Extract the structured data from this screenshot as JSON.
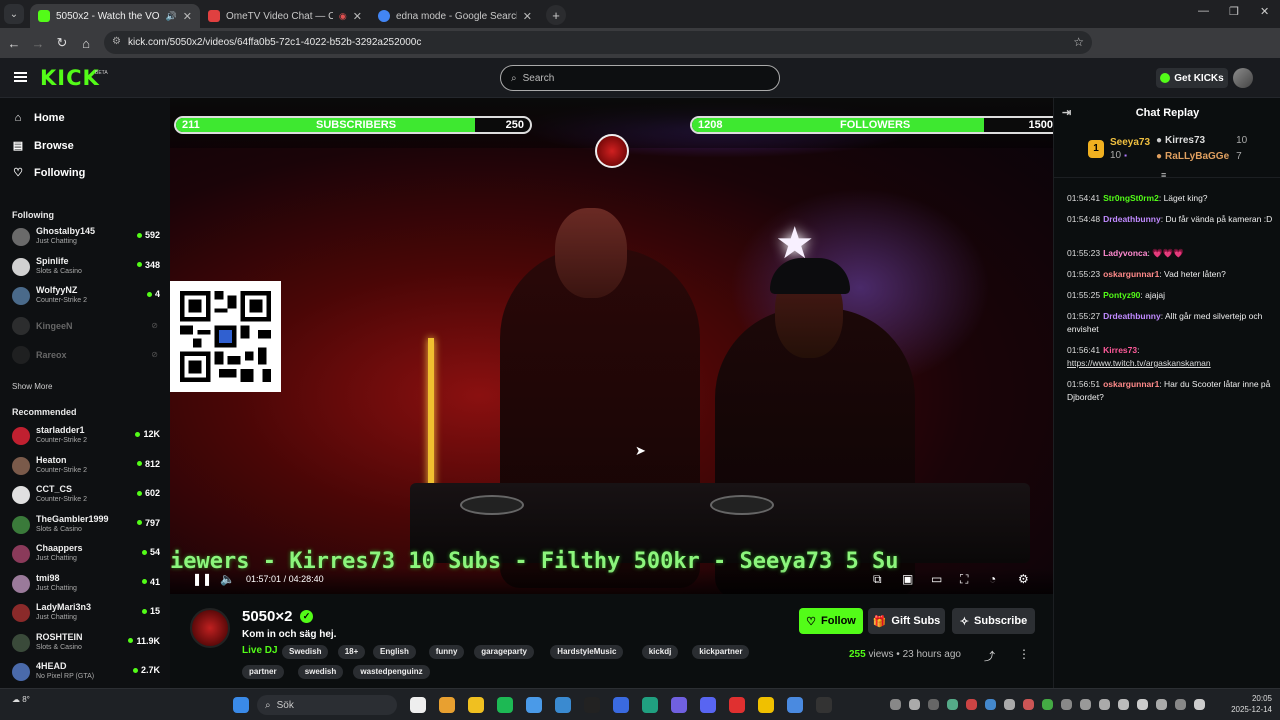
{
  "browser": {
    "tabs": [
      {
        "title": "5050x2 - Watch the VOD o",
        "active": true,
        "color": "#53fc18"
      },
      {
        "title": "OmeTV Video Chat — Ome",
        "active": false,
        "color": "#e04040"
      },
      {
        "title": "edna mode - Google Search",
        "active": false,
        "color": "#4285f4"
      }
    ],
    "url": "kick.com/5050x2/videos/64ffa0b5-72c1-4022-b52b-3292a252000c",
    "new_tab": "+",
    "close_glyph": "✕",
    "min_glyph": "—",
    "max_glyph": "❐"
  },
  "header": {
    "logo": "KICK",
    "beta": "BETA",
    "search_placeholder": "Search",
    "get_kicks": "Get KICKs"
  },
  "sidebar": {
    "nav": [
      {
        "label": "Home",
        "icon": "⌂"
      },
      {
        "label": "Browse",
        "icon": "▤"
      },
      {
        "label": "Following",
        "icon": "♡"
      }
    ],
    "following_title": "Following",
    "following": [
      {
        "name": "Ghostalby145",
        "category": "Just Chatting",
        "viewers": "592",
        "color": "#6a6a6a"
      },
      {
        "name": "Spinlife",
        "category": "Slots & Casino",
        "viewers": "348",
        "color": "#d0d0d0"
      },
      {
        "name": "WolfyyNZ",
        "category": "Counter-Strike 2",
        "viewers": "4",
        "color": "#4a6a8a"
      },
      {
        "name": "KingeeN",
        "category": "",
        "viewers": "",
        "color": "#5a5a5a"
      },
      {
        "name": "Rareox",
        "category": "",
        "viewers": "",
        "color": "#3a3a3a"
      }
    ],
    "show_more": "Show More",
    "recommended_title": "Recommended",
    "recommended": [
      {
        "name": "starladder1",
        "category": "Counter-Strike 2",
        "viewers": "12K",
        "color": "#c02030"
      },
      {
        "name": "Heaton",
        "category": "Counter-Strike 2",
        "viewers": "812",
        "color": "#7a5a4a"
      },
      {
        "name": "CCT_CS",
        "category": "Counter-Strike 2",
        "viewers": "602",
        "color": "#e0e0e0"
      },
      {
        "name": "TheGambler1999",
        "category": "Slots & Casino",
        "viewers": "797",
        "color": "#3a7a3a"
      },
      {
        "name": "Chaappers",
        "category": "Just Chatting",
        "viewers": "54",
        "color": "#8a3a5a"
      },
      {
        "name": "tmi98",
        "category": "Just Chatting",
        "viewers": "41",
        "color": "#9a7a9a"
      },
      {
        "name": "LadyMari3n3",
        "category": "Just Chatting",
        "viewers": "15",
        "color": "#8a2a2a"
      },
      {
        "name": "ROSHTEIN",
        "category": "Slots & Casino",
        "viewers": "11.9K",
        "color": "#3a4a3a"
      },
      {
        "name": "4HEAD",
        "category": "No Pixel RP (GTA)",
        "viewers": "2.7K",
        "color": "#4a6aaa"
      }
    ]
  },
  "video": {
    "subs": {
      "current": "211",
      "label": "SUBSCRIBERS",
      "goal": "250",
      "progress": 0.844
    },
    "followers": {
      "current": "1208",
      "label": "FOLLOWERS",
      "goal": "1500",
      "progress": 0.805
    },
    "ticker": "iewers - Kirres73 10 Subs - Filthy 500kr - Seeya73 5 Su",
    "time_current": "01:57:01",
    "time_total": "04:28:40",
    "time_sep": "/"
  },
  "stream": {
    "channel": "5050×2",
    "title": "Kom in och säg hej.",
    "category": "Live DJ",
    "tags": [
      "Swedish",
      "18+",
      "English",
      "funny",
      "garageparty",
      "HardstyleMusic",
      "kickdj",
      "kickpartner",
      "partner",
      "swedish",
      "wastedpenguinz"
    ],
    "follow": "Follow",
    "gift_subs": "Gift Subs",
    "subscribe": "Subscribe",
    "views_count": "255",
    "views_label": "views",
    "age": "23 hours ago",
    "dot": "•"
  },
  "chat": {
    "title": "Chat Replay",
    "leaderboard": [
      {
        "rank": "1",
        "name": "Seeya73",
        "points": "10",
        "color": "#f0c040"
      },
      {
        "rank": "",
        "name": "Kirres73",
        "points": "10",
        "color": "#dddddd"
      },
      {
        "rank": "",
        "name": "RaLLyBaGGe",
        "points": "7",
        "color": "#e0a060"
      }
    ],
    "messages": [
      {
        "time": "01:54:41",
        "user": "Str0ngSt0rm2",
        "text": "Läget king?",
        "color": "#53fc18"
      },
      {
        "time": "01:54:48",
        "user": "Drdeathbunny",
        "text": "Du får vända på kameran :D",
        "color": "#c08aff"
      },
      {
        "time": "01:55:23",
        "user": "Ladyvonca",
        "text": "💗💗💗",
        "color": "#ff8ad0"
      },
      {
        "time": "01:55:23",
        "user": "oskargunnar1",
        "text": "Vad heter låten?",
        "color": "#ff8a8a"
      },
      {
        "time": "01:55:25",
        "user": "Pontyz90",
        "text": "ajajaj",
        "color": "#53fc18"
      },
      {
        "time": "01:55:27",
        "user": "Drdeathbunny",
        "text": "Allt går med silvertejp och envishet",
        "color": "#c08aff"
      },
      {
        "time": "01:56:41",
        "user": "Kirres73",
        "text": "https://www.twitch.tv/argaskanskaman",
        "color": "#ff5a9a"
      },
      {
        "time": "01:56:51",
        "user": "oskargunnar1",
        "text": "Har du Scooter låtar inne på Djbordet?",
        "color": "#ff8a8a"
      }
    ]
  },
  "taskbar": {
    "search": "Sök",
    "time": "20:05",
    "date": "2025-12-14",
    "weather": "8°"
  }
}
